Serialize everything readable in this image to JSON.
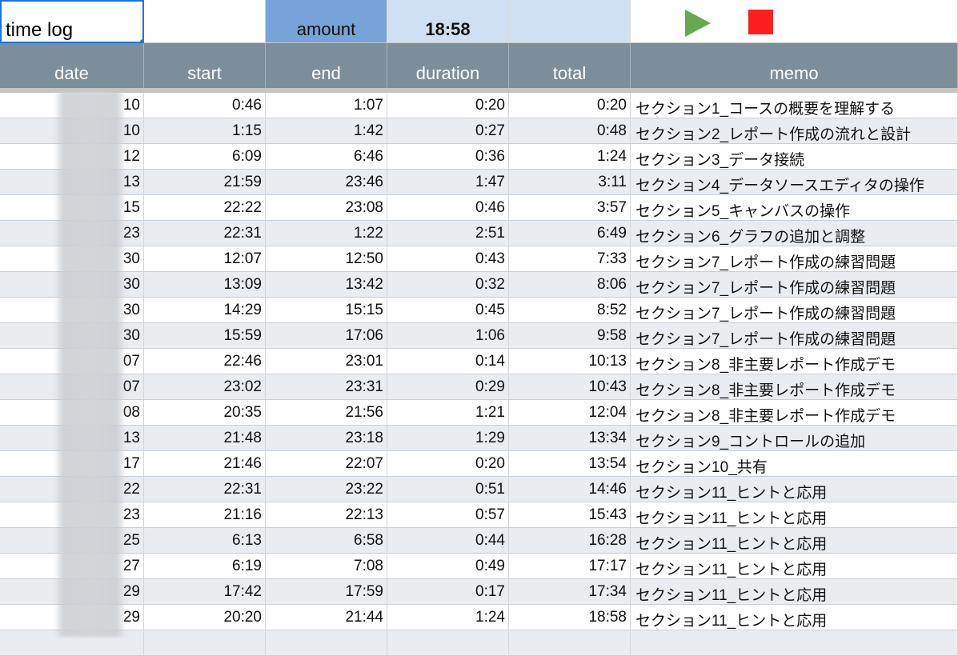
{
  "sheet": {
    "title": "time log",
    "amount_label": "amount",
    "amount_value": "18:58"
  },
  "controls": {
    "play_icon": "play-icon",
    "stop_icon": "stop-icon",
    "play_color": "#6aa84f",
    "stop_color": "#ff1f1f"
  },
  "columns": [
    "date",
    "start",
    "end",
    "duration",
    "total",
    "memo"
  ],
  "rows": [
    {
      "date": "10",
      "start": "0:46",
      "end": "1:07",
      "duration": "0:20",
      "total": "0:20",
      "memo": "セクション1_コースの概要を理解する"
    },
    {
      "date": "10",
      "start": "1:15",
      "end": "1:42",
      "duration": "0:27",
      "total": "0:48",
      "memo": "セクション2_レポート作成の流れと設計"
    },
    {
      "date": "12",
      "start": "6:09",
      "end": "6:46",
      "duration": "0:36",
      "total": "1:24",
      "memo": "セクション3_データ接続"
    },
    {
      "date": "13",
      "start": "21:59",
      "end": "23:46",
      "duration": "1:47",
      "total": "3:11",
      "memo": "セクション4_データソースエディタの操作"
    },
    {
      "date": "15",
      "start": "22:22",
      "end": "23:08",
      "duration": "0:46",
      "total": "3:57",
      "memo": "セクション5_キャンバスの操作"
    },
    {
      "date": "23",
      "start": "22:31",
      "end": "1:22",
      "duration": "2:51",
      "total": "6:49",
      "memo": "セクション6_グラフの追加と調整"
    },
    {
      "date": "30",
      "start": "12:07",
      "end": "12:50",
      "duration": "0:43",
      "total": "7:33",
      "memo": "セクション7_レポート作成の練習問題"
    },
    {
      "date": "30",
      "start": "13:09",
      "end": "13:42",
      "duration": "0:32",
      "total": "8:06",
      "memo": "セクション7_レポート作成の練習問題"
    },
    {
      "date": "30",
      "start": "14:29",
      "end": "15:15",
      "duration": "0:45",
      "total": "8:52",
      "memo": "セクション7_レポート作成の練習問題"
    },
    {
      "date": "30",
      "start": "15:59",
      "end": "17:06",
      "duration": "1:06",
      "total": "9:58",
      "memo": "セクション7_レポート作成の練習問題"
    },
    {
      "date": "07",
      "start": "22:46",
      "end": "23:01",
      "duration": "0:14",
      "total": "10:13",
      "memo": "セクション8_非主要レポート作成デモ"
    },
    {
      "date": "07",
      "start": "23:02",
      "end": "23:31",
      "duration": "0:29",
      "total": "10:43",
      "memo": "セクション8_非主要レポート作成デモ"
    },
    {
      "date": "08",
      "start": "20:35",
      "end": "21:56",
      "duration": "1:21",
      "total": "12:04",
      "memo": "セクション8_非主要レポート作成デモ"
    },
    {
      "date": "13",
      "start": "21:48",
      "end": "23:18",
      "duration": "1:29",
      "total": "13:34",
      "memo": "セクション9_コントロールの追加"
    },
    {
      "date": "17",
      "start": "21:46",
      "end": "22:07",
      "duration": "0:20",
      "total": "13:54",
      "memo": "セクション10_共有"
    },
    {
      "date": "22",
      "start": "22:31",
      "end": "23:22",
      "duration": "0:51",
      "total": "14:46",
      "memo": "セクション11_ヒントと応用"
    },
    {
      "date": "23",
      "start": "21:16",
      "end": "22:13",
      "duration": "0:57",
      "total": "15:43",
      "memo": "セクション11_ヒントと応用"
    },
    {
      "date": "25",
      "start": "6:13",
      "end": "6:58",
      "duration": "0:44",
      "total": "16:28",
      "memo": "セクション11_ヒントと応用"
    },
    {
      "date": "27",
      "start": "6:19",
      "end": "7:08",
      "duration": "0:49",
      "total": "17:17",
      "memo": "セクション11_ヒントと応用"
    },
    {
      "date": "29",
      "start": "17:42",
      "end": "17:59",
      "duration": "0:17",
      "total": "17:34",
      "memo": "セクション11_ヒントと応用"
    },
    {
      "date": "29",
      "start": "20:20",
      "end": "21:44",
      "duration": "1:24",
      "total": "18:58",
      "memo": "セクション11_ヒントと応用"
    }
  ]
}
